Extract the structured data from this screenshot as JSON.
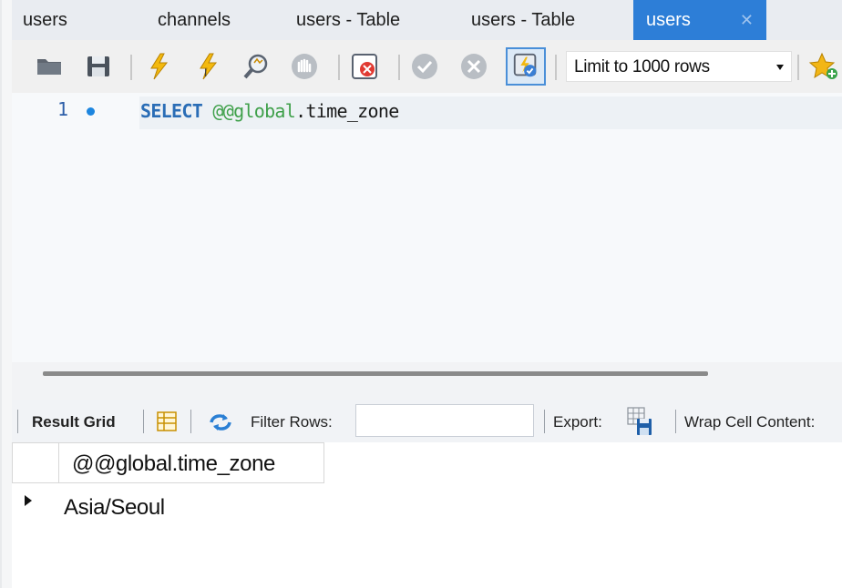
{
  "tabs": [
    {
      "label": "users",
      "active": false
    },
    {
      "label": "channels",
      "active": false
    },
    {
      "label": "users - Table",
      "active": false
    },
    {
      "label": "users - Table",
      "active": false
    },
    {
      "label": "users",
      "active": true
    }
  ],
  "toolbar": {
    "icons": [
      "open-folder-icon",
      "save-icon",
      "execute-icon",
      "execute-current-icon",
      "explain-icon",
      "stop-icon",
      "toggle-error-icon",
      "commit-icon",
      "rollback-icon",
      "autocommit-icon",
      "add-snippet-icon"
    ],
    "limit_label": "Limit to 1000 rows"
  },
  "editor": {
    "line_number": "1",
    "code": {
      "keyword": "SELECT",
      "variable": "@@global",
      "rest": ".time_zone"
    }
  },
  "result_toolbar": {
    "result_grid_label": "Result Grid",
    "filter_label": "Filter Rows:",
    "filter_value": "",
    "export_label": "Export:",
    "wrap_label": "Wrap Cell Content:"
  },
  "grid": {
    "columns": [
      "@@global.time_zone"
    ],
    "rows": [
      [
        "Asia/Seoul"
      ]
    ]
  },
  "colors": {
    "active_tab": "#2d7ed7",
    "keyword": "#2a6db6",
    "variable": "#3fa04a"
  }
}
